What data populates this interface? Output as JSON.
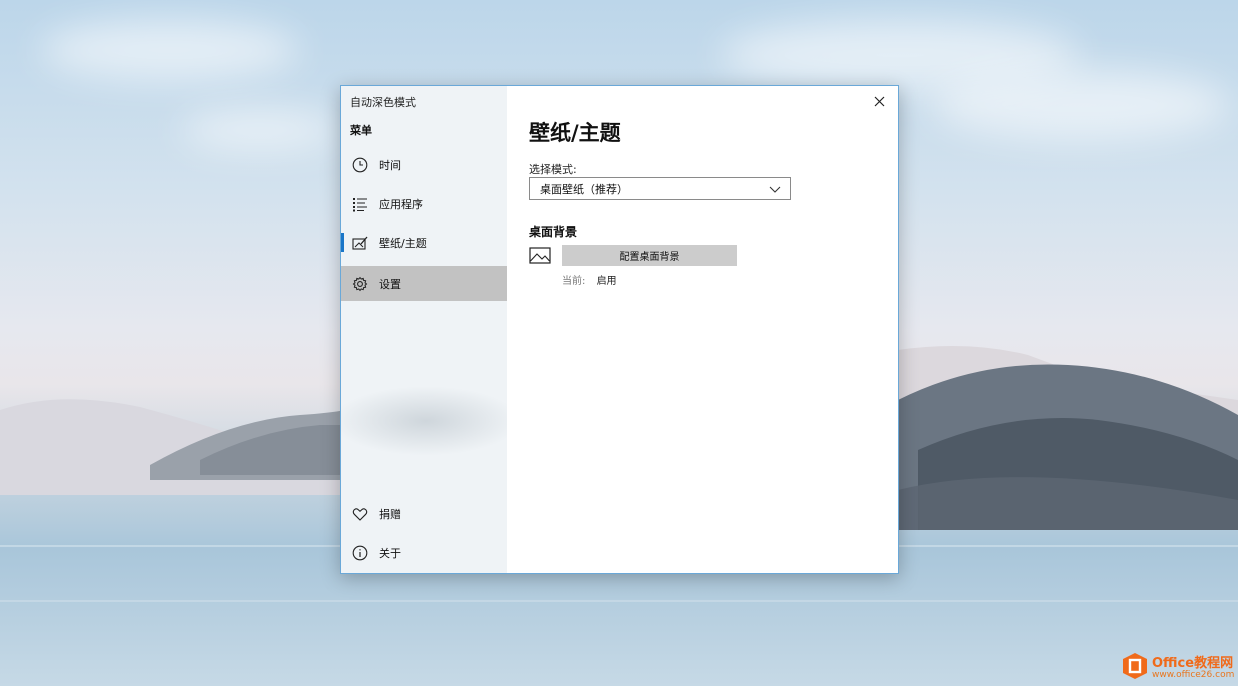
{
  "window": {
    "app_title": "自动深色模式",
    "menu_label": "菜单",
    "nav_items": [
      {
        "label": "时间",
        "icon": "clock-icon"
      },
      {
        "label": "应用程序",
        "icon": "list-icon"
      },
      {
        "label": "壁纸/主题",
        "icon": "wallpaper-icon"
      },
      {
        "label": "设置",
        "icon": "gear-icon"
      }
    ],
    "bottom_items": [
      {
        "label": "捐赠",
        "icon": "heart-icon"
      },
      {
        "label": "关于",
        "icon": "info-icon"
      }
    ],
    "selected_item": "壁纸/主题",
    "hovered_item": "设置"
  },
  "content": {
    "title": "壁纸/主题",
    "mode_label": "选择模式:",
    "mode_value": "桌面壁纸（推荐）",
    "section_title": "桌面背景",
    "config_button": "配置桌面背景",
    "current_key": "当前:",
    "current_value": "启用"
  },
  "watermark": {
    "brand": "Office教程网",
    "url": "www.office26.com"
  },
  "colors": {
    "accent": "#1a76c8",
    "hover": "#c2c2c2",
    "button": "#cccccc",
    "watermark": "#f06a1a"
  }
}
